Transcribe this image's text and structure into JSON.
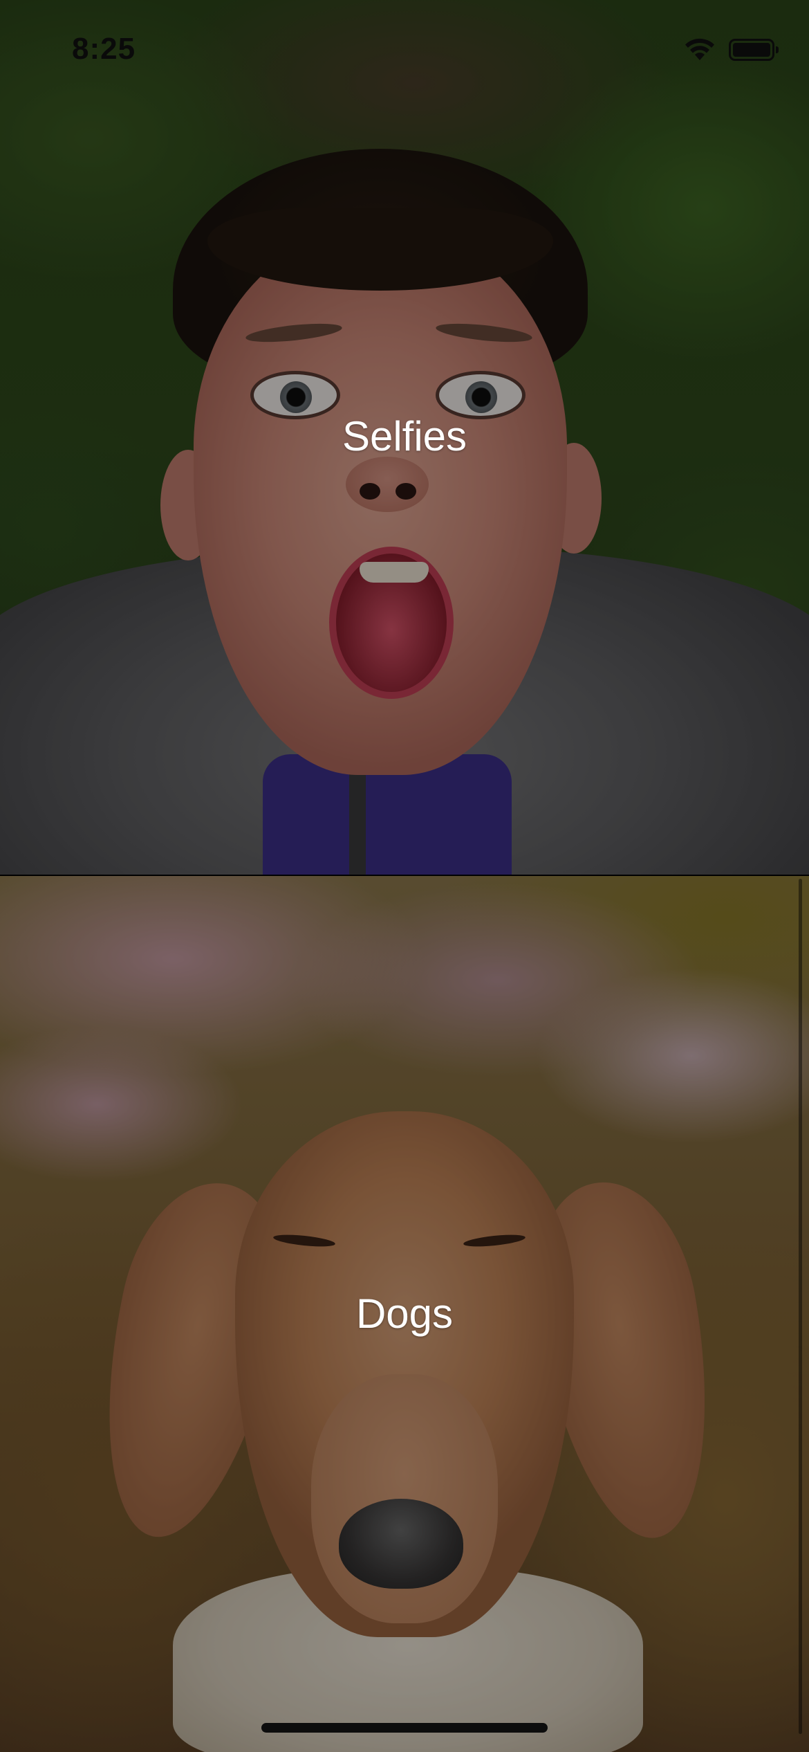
{
  "status_bar": {
    "time": "8:25",
    "wifi_icon": "wifi-icon",
    "battery_icon": "battery-icon"
  },
  "categories": [
    {
      "label": "Selfies",
      "image": "boy-selfie-photo"
    },
    {
      "label": "Dogs",
      "image": "dachshund-photo"
    }
  ],
  "colors": {
    "label_text": "#ffffff",
    "overlay": "#000000",
    "status_text": "#0a0a0a"
  }
}
